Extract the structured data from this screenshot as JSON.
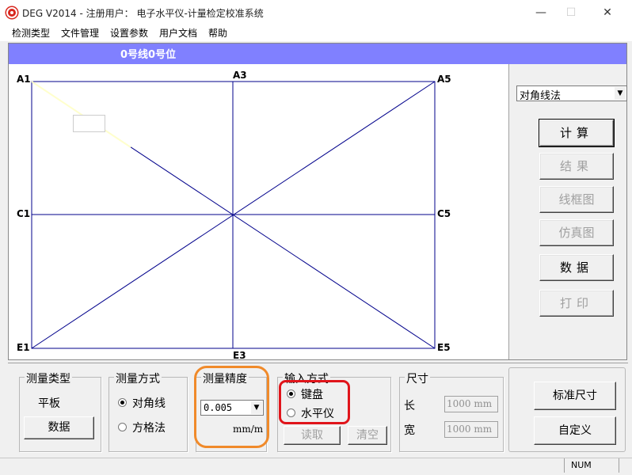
{
  "window": {
    "title": "DEG V2014 -  注册用户： 电子水平仪-计量检定校准系统",
    "minimize_glyph": "—",
    "maximize_glyph": "☐",
    "close_glyph": "✕"
  },
  "menu": [
    "检测类型",
    "文件管理",
    "设置参数",
    "用户文档",
    "帮助"
  ],
  "canvas": {
    "header": "0号线0号位",
    "points": {
      "a1": "A1",
      "a3": "A3",
      "a5": "A5",
      "c1": "C1",
      "c5": "C5",
      "e1": "E1",
      "e3": "E3",
      "e5": "E5"
    }
  },
  "right_panel": {
    "method_value": "对角线法",
    "buttons": {
      "calc": "计算",
      "result": "结果",
      "wireframe": "线框图",
      "simulate": "仿真图",
      "data": "数据",
      "print": "打印"
    }
  },
  "bottom": {
    "type_group": {
      "title": "测量类型",
      "value": "平板",
      "button": "数据"
    },
    "mode_group": {
      "title": "测量方式",
      "option1": "对角线",
      "option2": "方格法",
      "selected": "对角线"
    },
    "precision_group": {
      "title": "测量精度",
      "value": "0.005",
      "unit": "mm/m"
    },
    "input_group": {
      "title": "输入方式",
      "option1": "键盘",
      "option2": "水平仪",
      "selected": "键盘",
      "read_button": "读取",
      "clear_button": "清空"
    },
    "size_group": {
      "title": "尺寸",
      "length_label": "长",
      "length_value": "1000 mm",
      "width_label": "宽",
      "width_value": "1000 mm"
    },
    "std_size_button": "标准尺寸",
    "custom_button": "自定义"
  },
  "statusbar": {
    "left": "",
    "right": "NUM"
  },
  "colors": {
    "accent_bar": "#8080ff",
    "grid_lines": "#00008b",
    "highlight_orange": "#f08a2a",
    "highlight_red": "#e0151b"
  }
}
